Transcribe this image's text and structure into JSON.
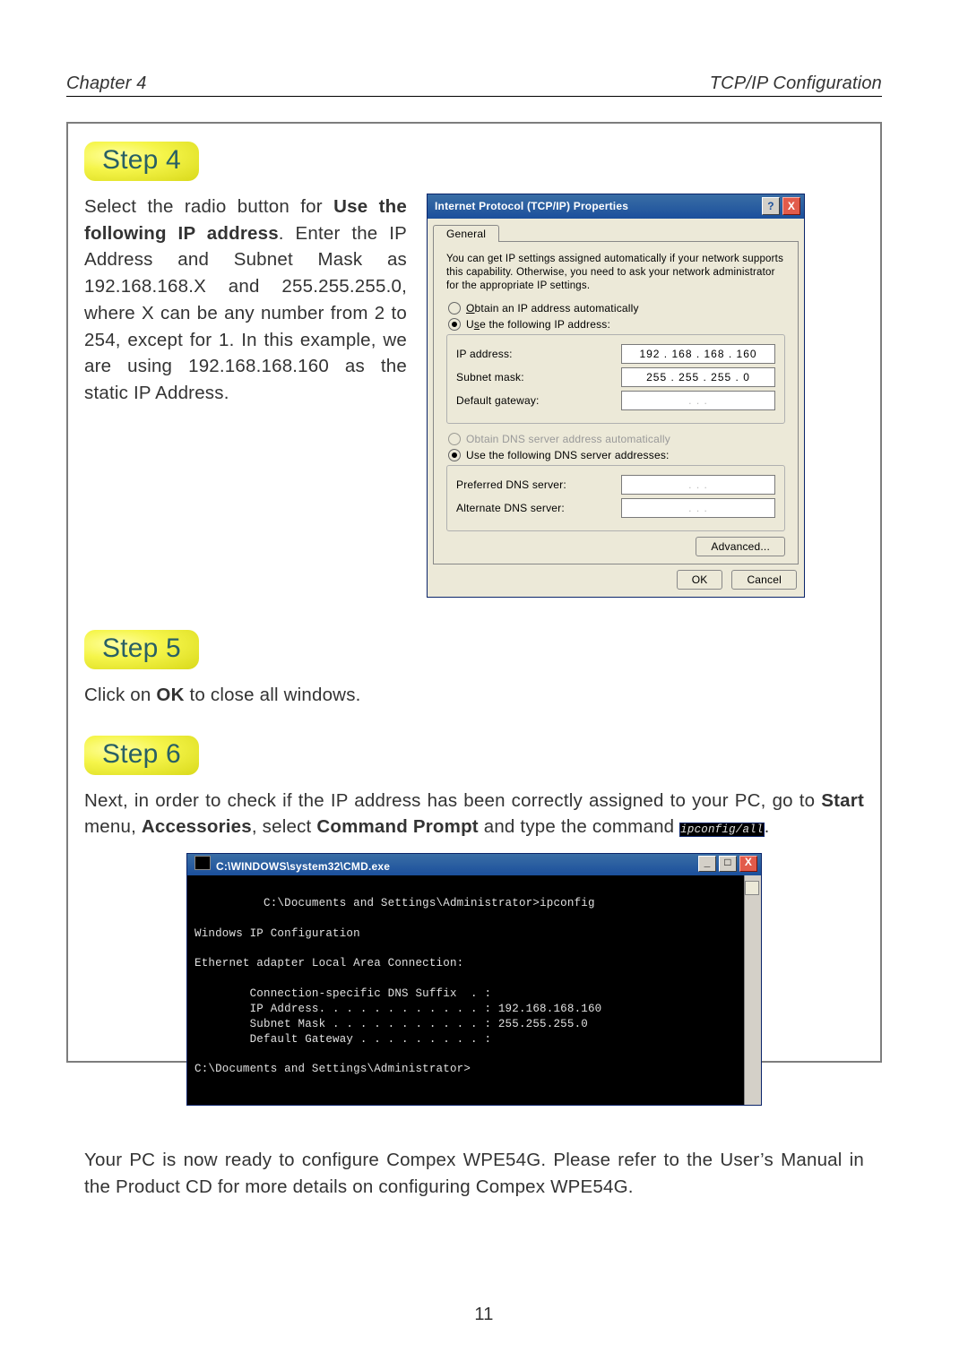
{
  "header": {
    "left": "Chapter 4",
    "right": "TCP/IP Configuration"
  },
  "page_number": "11",
  "steps": {
    "s4": "Step 4",
    "s5": "Step 5",
    "s6": "Step 6"
  },
  "step4_text": {
    "t1": "Select the radio button for ",
    "t2": "Use the following IP address",
    "t3": ". Enter the IP Address and Subnet Mask as 192.168.168.X and 255.255.255.0, where X can be any number from 2 to 254, except for 1. In this example, we are using 192.168.168.160 as the static IP Address."
  },
  "step5_text": {
    "t1": "Click on ",
    "ok": "OK",
    "t2": " to close all windows."
  },
  "step6_text": {
    "t1": "Next, in order to check if the IP address has been correctly assigned to your PC, go to ",
    "start": "Start",
    "t2": " menu, ",
    "acc": "Accessories",
    "t3": ", select ",
    "cmdp": "Command Prompt",
    "t4": " and type the command ",
    "cmd": "ipconfig/all",
    "t5": "."
  },
  "closing": "Your PC is now ready to configure Compex WPE54G. Please refer to the User’s Manual in the Product CD for more details on configuring Compex WPE54G.",
  "dlg": {
    "title": "Internet Protocol (TCP/IP) Properties",
    "tab": "General",
    "desc": "You can get IP settings assigned automatically if your network supports this capability. Otherwise, you need to ask your network administrator for the appropriate IP settings.",
    "r1": "Obtain an IP address automatically",
    "r2": "Use the following IP address:",
    "ip_lbl": "IP address:",
    "ip_val": "192 . 168 . 168 . 160",
    "sn_lbl": "Subnet mask:",
    "sn_val": "255 . 255 . 255 .  0",
    "gw_lbl": "Default gateway:",
    "gw_val": ".        .        .",
    "r3": "Obtain DNS server address automatically",
    "r4": "Use the following DNS server addresses:",
    "pdns_lbl": "Preferred DNS server:",
    "pdns_val": ".        .        .",
    "adns_lbl": "Alternate DNS server:",
    "adns_val": ".        .        .",
    "adv": "Advanced...",
    "ok": "OK",
    "cancel": "Cancel",
    "help": "?",
    "close": "X"
  },
  "cmd": {
    "title": "C:\\WINDOWS\\system32\\CMD.exe",
    "body": "C:\\Documents and Settings\\Administrator>ipconfig\n\nWindows IP Configuration\n\nEthernet adapter Local Area Connection:\n\n        Connection-specific DNS Suffix  . :\n        IP Address. . . . . . . . . . . . : 192.168.168.160\n        Subnet Mask . . . . . . . . . . . : 255.255.255.0\n        Default Gateway . . . . . . . . . :\n\nC:\\Documents and Settings\\Administrator>",
    "min": "_",
    "max": "□",
    "close": "X"
  }
}
